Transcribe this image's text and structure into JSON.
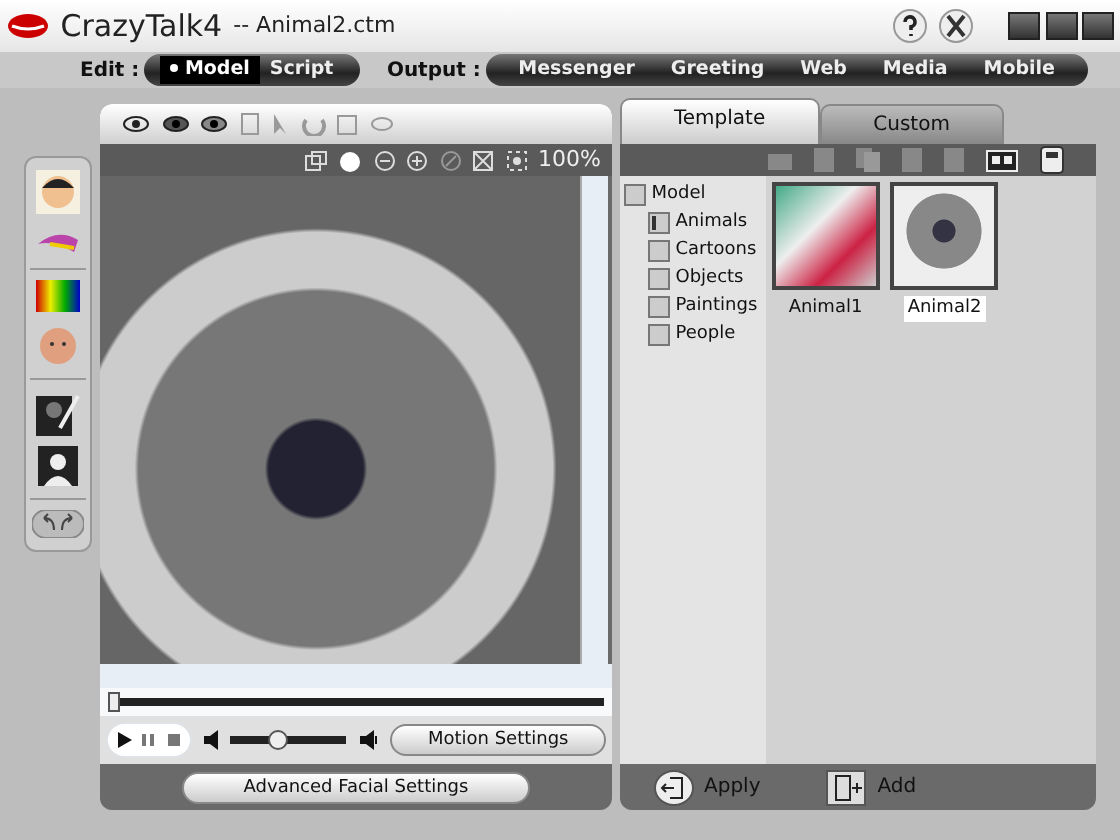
{
  "window": {
    "app_name": "CrazyTalk4",
    "title": "-- Animal2.ctm"
  },
  "mode_bar": {
    "edit_label": "Edit :",
    "edit_modes": [
      {
        "label": "Model",
        "selected": true
      },
      {
        "label": "Script",
        "selected": false
      }
    ],
    "output_label": "Output :",
    "outputs": [
      "Messenger",
      "Greeting",
      "Web",
      "Media",
      "Mobile"
    ]
  },
  "viewer": {
    "zoom": "100%",
    "timeline": {
      "level": 0
    },
    "volume": {
      "level": 0.4
    },
    "motion_button": "Motion Settings",
    "facial_button": "Advanced Facial Settings"
  },
  "library": {
    "tabs": [
      {
        "label": "Template",
        "selected": true
      },
      {
        "label": "Custom",
        "selected": false
      }
    ],
    "tree": [
      {
        "label": "Model",
        "children": [
          {
            "label": "Animals",
            "selected": true
          },
          {
            "label": "Cartoons",
            "selected": false
          },
          {
            "label": "Objects",
            "selected": false
          },
          {
            "label": "Paintings",
            "selected": false
          },
          {
            "label": "People",
            "selected": false
          }
        ]
      }
    ],
    "items": [
      {
        "label": "Animal1",
        "selected": false
      },
      {
        "label": "Animal2",
        "selected": true
      }
    ],
    "actions": [
      "Apply",
      "Add"
    ]
  }
}
